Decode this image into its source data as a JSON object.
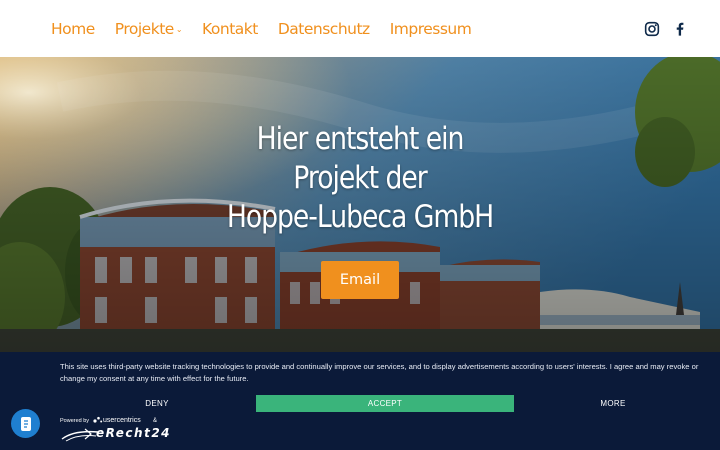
{
  "nav": {
    "links": {
      "home": "Home",
      "projekte": "Projekte",
      "kontakt": "Kontakt",
      "datenschutz": "Datenschutz",
      "impressum": "Impressum"
    },
    "projekte_caret": "⌄",
    "social_icons": [
      "instagram-icon",
      "facebook-icon"
    ]
  },
  "hero": {
    "title_line1": "Hier entsteht ein",
    "title_line2": "Projekt der",
    "title_line3": "Hoppe-Lubeca GmbH",
    "email_button": "Email"
  },
  "consent": {
    "text": "This site uses third-party website tracking technologies to provide and continually improve our services, and to display advertisements according to users' interests. I agree and may revoke or change my consent at any time with effect for the future.",
    "deny": "DENY",
    "accept": "ACCEPT",
    "more": "MORE",
    "powered_by": "Powered by",
    "usercentrics": "usercentrics",
    "ampersand": "&",
    "erecht": "eRecht24"
  },
  "colors": {
    "accent": "#f0901e",
    "banner_bg": "#0b1a39",
    "accept_bg": "#3ab47b",
    "fab_bg": "#1f7fd0"
  }
}
